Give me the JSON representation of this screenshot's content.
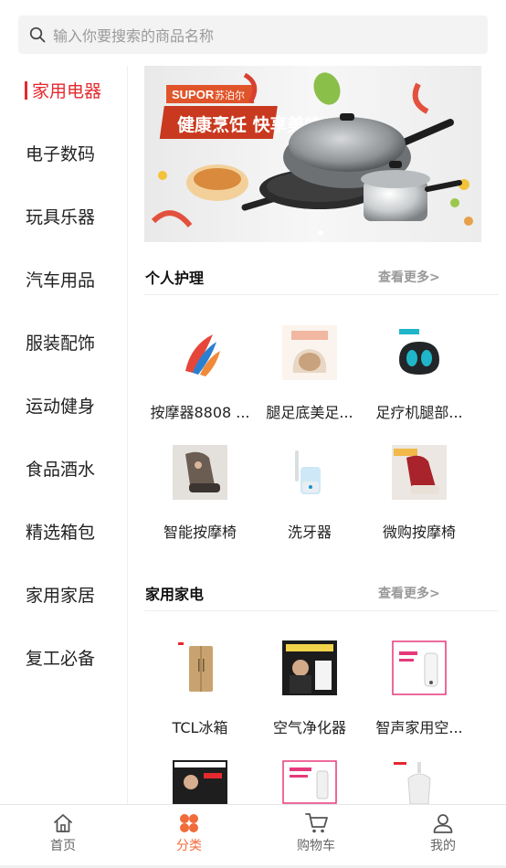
{
  "search": {
    "placeholder": "输入你要搜索的商品名称",
    "icon": "search-icon"
  },
  "sidebar": {
    "items": [
      {
        "label": "家用电器",
        "active": true
      },
      {
        "label": "电子数码"
      },
      {
        "label": "玩具乐器"
      },
      {
        "label": "汽车用品"
      },
      {
        "label": "服装配饰"
      },
      {
        "label": "运动健身"
      },
      {
        "label": "食品酒水"
      },
      {
        "label": "精选箱包"
      },
      {
        "label": "家用家居"
      },
      {
        "label": "复工必备"
      }
    ]
  },
  "banner": {
    "brand": "SUPOR",
    "brand_cn": "苏泊尔",
    "slogan": "健康烹饪 快享美味"
  },
  "sections": [
    {
      "title": "个人护理",
      "more": "查看更多>",
      "products": [
        {
          "name": "按摩器8808 ..."
        },
        {
          "name": "腿足底美足..."
        },
        {
          "name": "足疗机腿部..."
        },
        {
          "name": "智能按摩椅"
        },
        {
          "name": "洗牙器"
        },
        {
          "name": "微购按摩椅"
        }
      ]
    },
    {
      "title": "家用家电",
      "more": "查看更多>",
      "products": [
        {
          "name": "TCL冰箱"
        },
        {
          "name": "空气净化器"
        },
        {
          "name": "智声家用空..."
        }
      ]
    }
  ],
  "tabbar": {
    "items": [
      {
        "label": "首页",
        "icon": "home-icon"
      },
      {
        "label": "分类",
        "icon": "category-icon",
        "active": true
      },
      {
        "label": "购物车",
        "icon": "cart-icon"
      },
      {
        "label": "我的",
        "icon": "user-icon"
      }
    ]
  },
  "colors": {
    "accent": "#e4292f",
    "tab_active": "#f26b3a"
  }
}
